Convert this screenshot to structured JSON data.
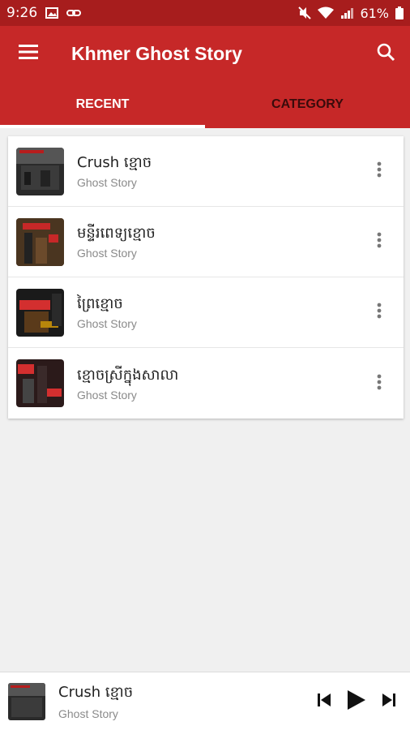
{
  "status_bar": {
    "time": "9:26",
    "battery": "61%",
    "icons": [
      "image-icon",
      "link-icon",
      "mute-icon",
      "wifi-icon",
      "signal-icon",
      "battery-icon"
    ]
  },
  "app_bar": {
    "title": "Khmer Ghost Story",
    "color": "#c62828"
  },
  "tabs": [
    {
      "label": "RECENT",
      "selected": true
    },
    {
      "label": "CATEGORY",
      "selected": false
    }
  ],
  "stories": [
    {
      "title": "Crush ខ្មោច",
      "category": "Ghost Story"
    },
    {
      "title": "មន្ទីរពេទ្យខ្មោច",
      "category": "Ghost Story"
    },
    {
      "title": "ព្រៃខ្មោច",
      "category": "Ghost Story"
    },
    {
      "title": "ខ្មោចស្រីក្នុងសាលា",
      "category": "Ghost Story"
    }
  ],
  "player": {
    "title": "Crush ខ្មោច",
    "category": "Ghost Story"
  }
}
